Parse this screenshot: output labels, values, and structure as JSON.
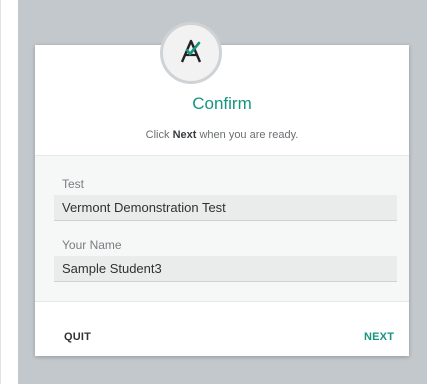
{
  "dialog": {
    "title": "Confirm",
    "instruction_prefix": "Click ",
    "instruction_bold": "Next",
    "instruction_suffix": " when you are ready."
  },
  "form": {
    "test_label": "Test",
    "test_value": "Vermont Demonstration Test",
    "name_label": "Your Name",
    "name_value": "Sample Student3"
  },
  "buttons": {
    "quit_label": "QUIT",
    "next_label": "NEXT"
  },
  "logo": {
    "icon": "logo-a-check-icon",
    "accent_color": "#17947f"
  }
}
